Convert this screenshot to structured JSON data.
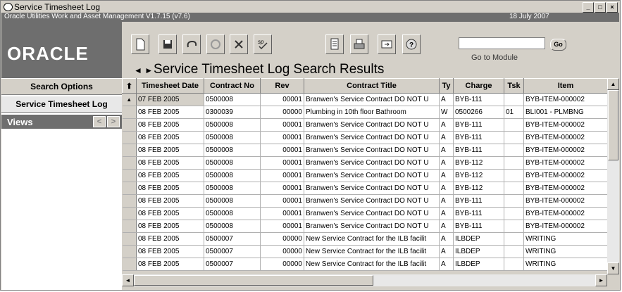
{
  "window": {
    "title": "Service Timesheet Log",
    "subtitle": "Oracle Utilities Work and Asset Management V1.7.15 (v7.6)",
    "date": "18 July   2007",
    "controls": [
      "_",
      "□",
      "×"
    ]
  },
  "logo": "ORACLE",
  "nav": {
    "search_options": "Search Options",
    "service_timesheet_log": "Service Timesheet Log",
    "views": "Views"
  },
  "toolbar": {
    "go_to_module_label": "Go to Module",
    "go_button": "Go",
    "go_value": ""
  },
  "page": {
    "title": "Service Timesheet Log Search Results",
    "prev": "◄",
    "next": "►"
  },
  "grid": {
    "columns": [
      "Timesheet Date",
      "Contract No",
      "Rev",
      "Contract Title",
      "Ty",
      "Charge",
      "Tsk",
      "Item"
    ],
    "rows": [
      [
        "07 FEB 2005",
        "0500008",
        "00001",
        "Branwen's Service Contract DO NOT U",
        "A",
        "BYB-111",
        "",
        "BYB-ITEM-000002"
      ],
      [
        "08 FEB 2005",
        "0300039",
        "00000",
        "Plumbing in 10th floor Bathroom",
        "W",
        "0500266",
        "01",
        "BLI001 - PLMBNG"
      ],
      [
        "08 FEB 2005",
        "0500008",
        "00001",
        "Branwen's Service Contract DO NOT U",
        "A",
        "BYB-111",
        "",
        "BYB-ITEM-000002"
      ],
      [
        "08 FEB 2005",
        "0500008",
        "00001",
        "Branwen's Service Contract DO NOT U",
        "A",
        "BYB-111",
        "",
        "BYB-ITEM-000002"
      ],
      [
        "08 FEB 2005",
        "0500008",
        "00001",
        "Branwen's Service Contract DO NOT U",
        "A",
        "BYB-111",
        "",
        "BYB-ITEM-000002"
      ],
      [
        "08 FEB 2005",
        "0500008",
        "00001",
        "Branwen's Service Contract DO NOT U",
        "A",
        "BYB-112",
        "",
        "BYB-ITEM-000002"
      ],
      [
        "08 FEB 2005",
        "0500008",
        "00001",
        "Branwen's Service Contract DO NOT U",
        "A",
        "BYB-112",
        "",
        "BYB-ITEM-000002"
      ],
      [
        "08 FEB 2005",
        "0500008",
        "00001",
        "Branwen's Service Contract DO NOT U",
        "A",
        "BYB-112",
        "",
        "BYB-ITEM-000002"
      ],
      [
        "08 FEB 2005",
        "0500008",
        "00001",
        "Branwen's Service Contract DO NOT U",
        "A",
        "BYB-111",
        "",
        "BYB-ITEM-000002"
      ],
      [
        "08 FEB 2005",
        "0500008",
        "00001",
        "Branwen's Service Contract DO NOT U",
        "A",
        "BYB-111",
        "",
        "BYB-ITEM-000002"
      ],
      [
        "08 FEB 2005",
        "0500008",
        "00001",
        "Branwen's Service Contract DO NOT U",
        "A",
        "BYB-111",
        "",
        "BYB-ITEM-000002"
      ],
      [
        "08 FEB 2005",
        "0500007",
        "00000",
        "New Service Contract for the ILB facilit",
        "A",
        "ILBDEP",
        "",
        "WRITING"
      ],
      [
        "08 FEB 2005",
        "0500007",
        "00000",
        "New Service Contract for the ILB facilit",
        "A",
        "ILBDEP",
        "",
        "WRITING"
      ],
      [
        "08 FEB 2005",
        "0500007",
        "00000",
        "New Service Contract for the ILB facilit",
        "A",
        "ILBDEP",
        "",
        "WRITING"
      ]
    ]
  }
}
